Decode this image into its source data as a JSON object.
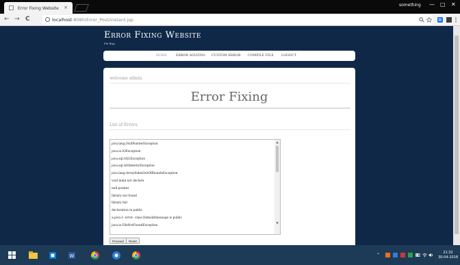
{
  "browser": {
    "tab_title": "Error Fixing Website",
    "tab_close": "×",
    "profile_name": "something",
    "window_controls": [
      "—",
      "▢",
      "✕"
    ],
    "url_host": "localhost",
    "url_path": ":8080/Error_Post/instant.jsp",
    "nav_icons": [
      "back-icon",
      "forward-icon",
      "reload-icon"
    ],
    "nav_glyphs": [
      "←",
      "→",
      "C"
    ],
    "toolbar_icons": [
      "zoom-icon",
      "bookmark-star-icon",
      "extension-icon",
      "extension-icon",
      "menu-icon"
    ]
  },
  "site": {
    "title": "Error Fixing Website",
    "subtitle": "Fix Bug"
  },
  "nav": {
    "items": [
      "HOME",
      "ERROR SOLVING",
      "CUSTOM ERROR",
      "COMPILE FILE",
      "LOGOUT"
    ],
    "active": "HOME"
  },
  "main": {
    "welcome": "welcome admin",
    "heading": "Error Fixing",
    "list_label": "List of Errors",
    "errors": [
      "java.lang.NullPointerException",
      "java.io.IOException",
      "java.sql.SQLException",
      "java.sql.ArithmeticException",
      "java.lang.ArrayIndexOutOfBoundsException",
      "void main not declare",
      "null pointer",
      "library not found",
      "library fail",
      "declaration in public",
      "a.java:1: error: class Demold/message is public",
      "java.io.FileNotFoundException"
    ],
    "buttons": {
      "proceed": "Proceed",
      "reset": "Reset"
    }
  },
  "taskbar": {
    "apps": [
      "file-explorer-icon",
      "store-icon",
      "word-icon",
      "chrome-icon",
      "settings-icon",
      "chrome-icon"
    ],
    "clock_time": "21:32",
    "clock_date": "30-04-2018"
  },
  "colors": {
    "page_bg": "#0f2847",
    "panel_bg": "#ffffff",
    "taskbar_bg": "#1d3a57",
    "nav_active": "#7a8db0"
  }
}
